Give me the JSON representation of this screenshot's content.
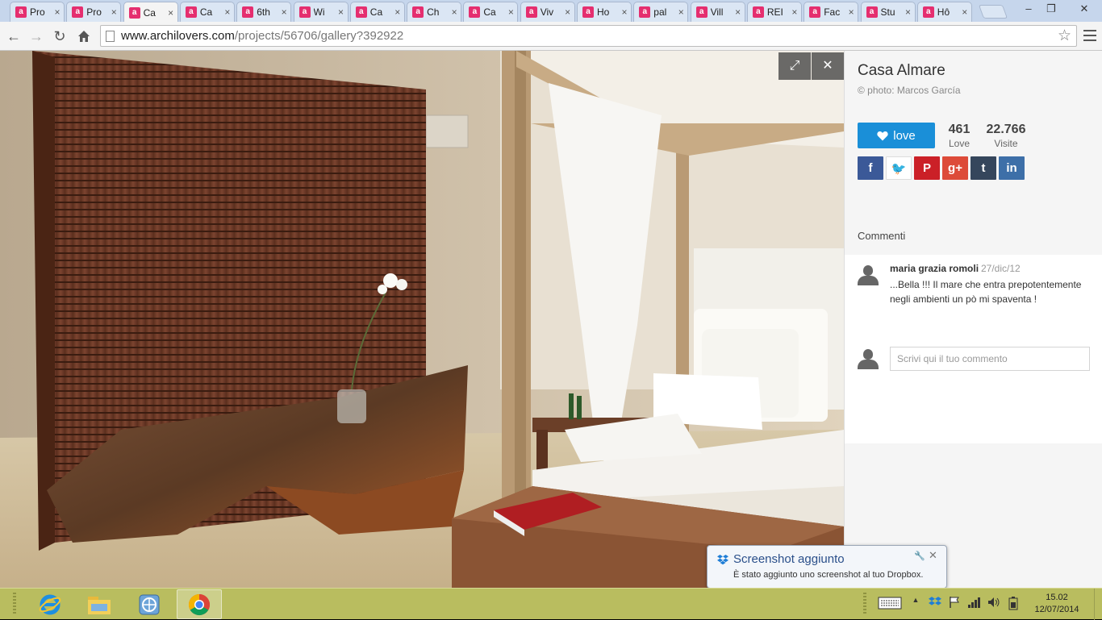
{
  "browser": {
    "tabs": [
      {
        "label": "Pro"
      },
      {
        "label": "Pro"
      },
      {
        "label": "Ca",
        "active": true
      },
      {
        "label": "Ca"
      },
      {
        "label": "6th"
      },
      {
        "label": "Wi"
      },
      {
        "label": "Ca"
      },
      {
        "label": "Ch"
      },
      {
        "label": "Ca"
      },
      {
        "label": "Viv"
      },
      {
        "label": "Ho"
      },
      {
        "label": "pal"
      },
      {
        "label": "Vill"
      },
      {
        "label": "REI"
      },
      {
        "label": "Fac"
      },
      {
        "label": "Stu"
      },
      {
        "label": "Hô"
      }
    ],
    "favicon_letter": "a",
    "tab_close": "×",
    "window_controls": {
      "minimize": "–",
      "restore": "❐",
      "close": "✕"
    },
    "url_host": "www.archilovers.com",
    "url_path": "/projects/56706/gallery?392922",
    "star_icon": "☆"
  },
  "gallery": {
    "expand_icon": "⤢",
    "close_icon": "✕"
  },
  "project": {
    "title": "Casa Almare",
    "credit": "© photo: Marcos García",
    "love_label": "love",
    "love_count": "461",
    "love_count_label": "Love",
    "visits": "22.766",
    "visits_label": "Visite",
    "share": [
      {
        "name": "facebook",
        "glyph": "f",
        "color": "#3b5998",
        "text_color": "#ffffff"
      },
      {
        "name": "twitter",
        "glyph": "🐦",
        "color": "#ffffff",
        "text_color": "#2aa9e0"
      },
      {
        "name": "pinterest",
        "glyph": "P",
        "color": "#cb2027",
        "text_color": "#ffffff"
      },
      {
        "name": "google-plus",
        "glyph": "g+",
        "color": "#dd4b39",
        "text_color": "#ffffff"
      },
      {
        "name": "tumblr",
        "glyph": "t",
        "color": "#35465c",
        "text_color": "#ffffff"
      },
      {
        "name": "linkedin",
        "glyph": "in",
        "color": "#3d6fa8",
        "text_color": "#ffffff"
      }
    ]
  },
  "comments": {
    "heading": "Commenti",
    "items": [
      {
        "author": "maria grazia romoli",
        "date": "27/dic/12",
        "text": "...Bella !!! Il mare che entra prepotentemente negli ambienti un pò mi spaventa !"
      }
    ],
    "input_placeholder": "Scrivi qui il tuo commento"
  },
  "notification": {
    "title": "Screenshot aggiunto",
    "message": "È stato aggiunto uno screenshot al tuo Dropbox.",
    "close_icon": "✕",
    "pin_icon": "🔧"
  },
  "taskbar": {
    "apps": [
      "internet-explorer",
      "file-explorer",
      "network-app",
      "chrome"
    ],
    "time": "15.02",
    "date": "12/07/2014",
    "tray_up_icon": "▲"
  }
}
